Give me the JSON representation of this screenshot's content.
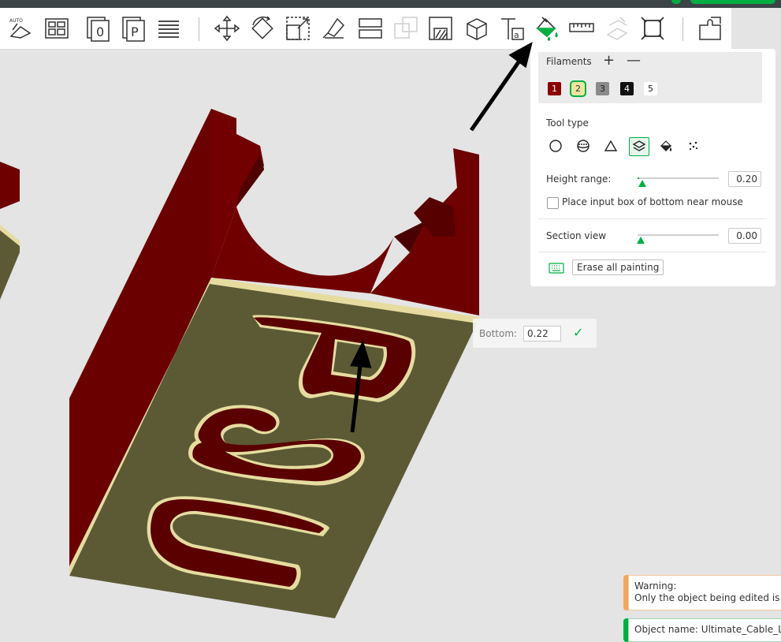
{
  "toolbar": {
    "buttons": [
      {
        "name": "auto-orient-icon",
        "text": "AUTO"
      },
      {
        "name": "arrange-icon"
      },
      {
        "name": "plate-o-icon",
        "text": "0"
      },
      {
        "name": "plate-p-icon",
        "text": "P"
      },
      {
        "name": "layers-list-icon"
      },
      {
        "name": "move-icon"
      },
      {
        "name": "rotate-icon"
      },
      {
        "name": "scale-icon"
      },
      {
        "name": "lay-on-face-icon"
      },
      {
        "name": "split-icon"
      },
      {
        "name": "boolean-icon"
      },
      {
        "name": "support-paint-icon"
      },
      {
        "name": "cube-icon"
      },
      {
        "name": "text-tool-icon",
        "text": "Ta"
      },
      {
        "name": "color-paint-icon"
      },
      {
        "name": "measure-icon"
      },
      {
        "name": "assembly-icon"
      },
      {
        "name": "fit-frame-icon"
      },
      {
        "name": "puzzle-icon"
      }
    ]
  },
  "paint_panel": {
    "filaments_label": "Filaments",
    "plus": "+",
    "minus": "—",
    "filaments": [
      {
        "id": "1",
        "color": "#8b0000",
        "text_color": "#ffffff",
        "selected": false
      },
      {
        "id": "2",
        "color": "#eee6a0",
        "text_color": "#333333",
        "selected": true
      },
      {
        "id": "3",
        "color": "#8a8a8a",
        "text_color": "#222222",
        "selected": false
      },
      {
        "id": "4",
        "color": "#111111",
        "text_color": "#ffffff",
        "selected": false
      },
      {
        "id": "5",
        "color": "#ffffff",
        "text_color": "#222222",
        "selected": false
      }
    ],
    "tool_type_label": "Tool type",
    "tools": [
      "circle-tool-icon",
      "sphere-tool-icon",
      "triangle-tool-icon",
      "height-range-tool-icon",
      "fill-bucket-icon",
      "gap-fill-icon"
    ],
    "active_tool": "height-range-tool-icon",
    "height_range_label": "Height range:",
    "height_range_value": "0.20",
    "height_range_level": 0.02,
    "place_input_label": "Place input box of bottom near mouse",
    "section_view_label": "Section view",
    "section_view_value": "0.00",
    "section_view_level": 0.0,
    "erase_label": "Erase all painting"
  },
  "bottom_popup": {
    "label": "Bottom:",
    "value": "0.22",
    "confirm": "✓"
  },
  "notifications": {
    "warning_title": "Warning:",
    "warning_text": "Only the object being edited is v",
    "object_text": "Object name: Ultimate_Cable_La"
  },
  "colors": {
    "accent": "#00ae42",
    "model_red": "#6e0000",
    "model_olive": "#5c5a35",
    "highlight_yellow": "#e6dca0"
  }
}
